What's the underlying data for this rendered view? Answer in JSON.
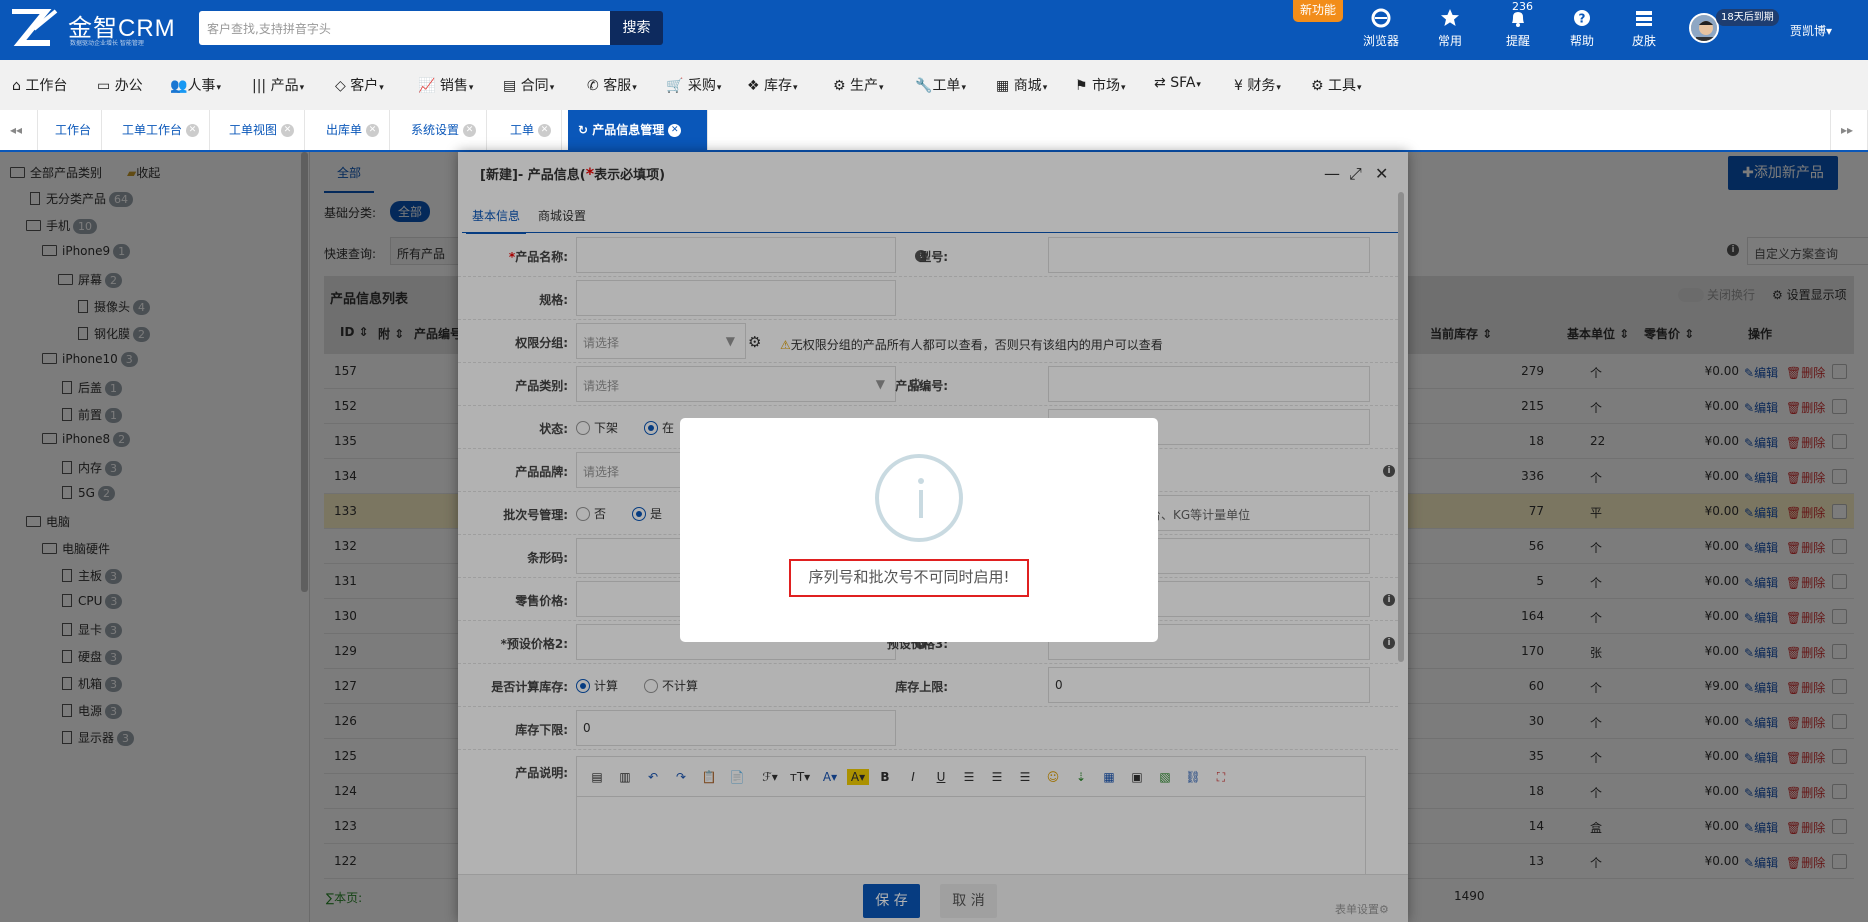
{
  "header": {
    "brand": "金智CRM",
    "brand_sub": "数据驱动企业增长 智能管理",
    "search_placeholder": "客户查找,支持拼音字头",
    "search_button": "搜索",
    "new_feature": "新功能",
    "tools": [
      "浏览器",
      "常用",
      "提醒",
      "帮助",
      "皮肤"
    ],
    "remind_count": "236",
    "trial_badge": "18天后到期",
    "user_name": "贾凯博▾"
  },
  "menu": [
    "工作台",
    "办公",
    "人事",
    "产品",
    "客户",
    "销售",
    "合同",
    "客服",
    "采购",
    "库存",
    "生产",
    "工单",
    "商城",
    "市场",
    "SFA",
    "财务",
    "工具"
  ],
  "tabs": [
    "工作台",
    "工单工作台",
    "工单视图",
    "出库单",
    "系统设置",
    "工单",
    "产品信息管理"
  ],
  "tree": {
    "root": "全部产品类别",
    "collect": "收起",
    "nodes": [
      {
        "label": "无分类产品",
        "count": "64"
      },
      {
        "label": "手机",
        "count": "10"
      },
      {
        "label": "iPhone9",
        "count": "1"
      },
      {
        "label": "屏幕",
        "count": "2"
      },
      {
        "label": "摄像头",
        "count": "4"
      },
      {
        "label": "钢化膜",
        "count": "2"
      },
      {
        "label": "iPhone10",
        "count": "3"
      },
      {
        "label": "后盖",
        "count": "1"
      },
      {
        "label": "前置",
        "count": "1"
      },
      {
        "label": "iPhone8",
        "count": "2"
      },
      {
        "label": "内存",
        "count": "3"
      },
      {
        "label": "5G",
        "count": "2"
      },
      {
        "label": "电脑",
        "count": ""
      },
      {
        "label": "电脑硬件",
        "count": ""
      },
      {
        "label": "主板",
        "count": "3"
      },
      {
        "label": "CPU",
        "count": "3"
      },
      {
        "label": "显卡",
        "count": "3"
      },
      {
        "label": "硬盘",
        "count": "3"
      },
      {
        "label": "机箱",
        "count": "3"
      },
      {
        "label": "电源",
        "count": "3"
      },
      {
        "label": "显示器",
        "count": "3"
      }
    ]
  },
  "main": {
    "tab_all": "全部",
    "base_category_label": "基础分类:",
    "base_category_value": "全部",
    "quick_query_label": "快速查询:",
    "quick_query_value": "所有产品",
    "list_title": "产品信息列表",
    "add_button": "✚添加新产品",
    "custom_query": "自定义方案查询",
    "close_wrap": "关闭换行",
    "display_settings": "设置显示项",
    "columns": {
      "id": "ID",
      "attach": "附",
      "code": "产品编号",
      "stock": "当前库存",
      "unit": "基本单位",
      "price": "零售价",
      "ops": "操作"
    },
    "edit_label": "编辑",
    "delete_label": "删除",
    "rows": [
      {
        "id": "157",
        "stock": "279",
        "unit": "个",
        "price": "¥0.00"
      },
      {
        "id": "152",
        "stock": "215",
        "unit": "个",
        "price": "¥0.00"
      },
      {
        "id": "135",
        "stock": "18",
        "unit": "22",
        "price": "¥0.00"
      },
      {
        "id": "134",
        "stock": "336",
        "unit": "个",
        "price": "¥0.00"
      },
      {
        "id": "133",
        "stock": "77",
        "unit": "平",
        "price": "¥0.00"
      },
      {
        "id": "132",
        "stock": "56",
        "unit": "个",
        "price": "¥0.00"
      },
      {
        "id": "131",
        "stock": "5",
        "unit": "个",
        "price": "¥0.00"
      },
      {
        "id": "130",
        "stock": "164",
        "unit": "个",
        "price": "¥0.00"
      },
      {
        "id": "129",
        "stock": "170",
        "unit": "张",
        "price": "¥0.00"
      },
      {
        "id": "127",
        "stock": "60",
        "unit": "个",
        "price": "¥9.00"
      },
      {
        "id": "126",
        "stock": "30",
        "unit": "个",
        "price": "¥0.00"
      },
      {
        "id": "125",
        "stock": "35",
        "unit": "个",
        "price": "¥0.00"
      },
      {
        "id": "124",
        "stock": "18",
        "unit": "个",
        "price": "¥0.00"
      },
      {
        "id": "123",
        "stock": "14",
        "unit": "盒",
        "price": "¥0.00"
      },
      {
        "id": "122",
        "stock": "13",
        "unit": "个",
        "price": "¥0.00"
      }
    ],
    "sum_label": "∑本页:",
    "sum_stock": "1490"
  },
  "form": {
    "title": "[新建]- 产品信息(",
    "title_req": "*",
    "title_tail": "表示必填项)",
    "tab_basic": "基本信息",
    "tab_mall": "商城设置",
    "product_name": "产品名称:",
    "model": "型号:",
    "spec": "规格:",
    "perm_group": "权限分组:",
    "please_select": "请选择",
    "perm_warning": "无权限分组的产品所有人都可以查看，否则只有该组内的用户可以查看",
    "category": "产品类别:",
    "product_code": "产品编号:",
    "status": "状态:",
    "off_shelf": "下架",
    "on_shelf": "在",
    "brand": "产品品牌:",
    "batch_mgmt": "批次号管理:",
    "no": "否",
    "yes": "是",
    "unit_hint": "台、KG等计量单位",
    "barcode": "条形码:",
    "retail_price": "零售价格:",
    "preset_price2": "*预设价格2:",
    "preset_price3": "预设价格3:",
    "calc_stock": "是否计算库存:",
    "calc": "计算",
    "not_calc": "不计算",
    "stock_max": "库存上限:",
    "stock_max_value": "0",
    "stock_min": "库存下限:",
    "stock_min_value": "0",
    "description": "产品说明:",
    "save": "保 存",
    "cancel": "取 消",
    "form_settings": "表单设置"
  },
  "alert": {
    "message": "序列号和批次号不可同时启用!"
  },
  "colors": {
    "primary": "#0a57b9",
    "danger": "#d03030",
    "accent": "#f28d1a"
  }
}
